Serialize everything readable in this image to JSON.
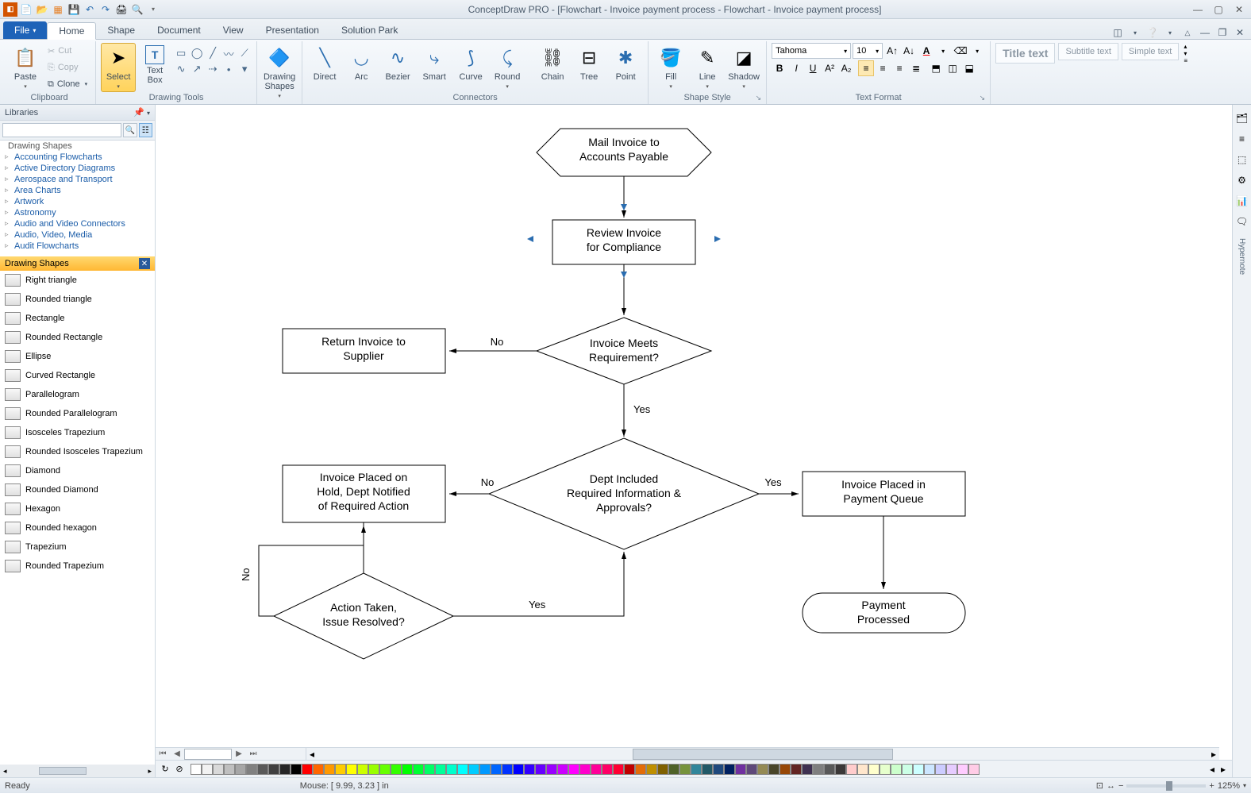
{
  "app": {
    "title": "ConceptDraw PRO - [Flowchart - Invoice payment process - Flowchart - Invoice payment process]"
  },
  "tabs": {
    "file": "File",
    "items": [
      "Home",
      "Shape",
      "Document",
      "View",
      "Presentation",
      "Solution Park"
    ],
    "active": 0
  },
  "ribbon": {
    "clipboard": {
      "label": "Clipboard",
      "paste": "Paste",
      "cut": "Cut",
      "copy": "Copy",
      "clone": "Clone"
    },
    "drawingtools": {
      "label": "Drawing Tools",
      "select": "Select",
      "textbox": "Text\nBox"
    },
    "drawingshapes": {
      "label": "Drawing\nShapes"
    },
    "connectors": {
      "label": "Connectors",
      "direct": "Direct",
      "arc": "Arc",
      "bezier": "Bezier",
      "smart": "Smart",
      "curve": "Curve",
      "round": "Round",
      "chain": "Chain",
      "tree": "Tree",
      "point": "Point"
    },
    "shapestyle": {
      "label": "Shape Style",
      "fill": "Fill",
      "line": "Line",
      "shadow": "Shadow"
    },
    "textformat": {
      "label": "Text Format",
      "font": "Tahoma",
      "size": "10"
    },
    "quickstyles": {
      "title": "Title\ntext",
      "subtitle": "Subtitle\ntext",
      "simple": "Simple\ntext"
    }
  },
  "leftpanel": {
    "header": "Libraries",
    "tree": [
      "Drawing Shapes",
      "Accounting Flowcharts",
      "Active Directory Diagrams",
      "Aerospace and Transport",
      "Area Charts",
      "Artwork",
      "Astronomy",
      "Audio and Video Connectors",
      "Audio, Video, Media",
      "Audit Flowcharts"
    ],
    "section": "Drawing Shapes",
    "shapes": [
      "Right triangle",
      "Rounded triangle",
      "Rectangle",
      "Rounded Rectangle",
      "Ellipse",
      "Curved Rectangle",
      "Parallelogram",
      "Rounded Parallelogram",
      "Isosceles Trapezium",
      "Rounded Isosceles Trapezium",
      "Diamond",
      "Rounded Diamond",
      "Hexagon",
      "Rounded hexagon",
      "Trapezium",
      "Rounded Trapezium"
    ]
  },
  "flowchart": {
    "n1": "Mail Invoice to\nAccounts Payable",
    "n2": "Review Invoice\nfor Compliance",
    "n3": "Invoice Meets\nRequirement?",
    "n4": "Return Invoice to\nSupplier",
    "n5": "Dept Included\nRequired Information &\nApprovals?",
    "n6": "Invoice Placed on\nHold, Dept Notified\nof Required Action",
    "n7": "Action Taken,\nIssue Resolved?",
    "n8": "Invoice Placed in\nPayment Queue",
    "n9": "Payment\nProcessed",
    "no": "No",
    "yes": "Yes"
  },
  "rightstrip": {
    "hypernote": "Hypernote"
  },
  "statusbar": {
    "ready": "Ready",
    "mouse": "Mouse: [ 9.99, 3.23 ] in",
    "zoom": "125%"
  },
  "colors": [
    "#ffffff",
    "#f2f2f2",
    "#d9d9d9",
    "#bfbfbf",
    "#a6a6a6",
    "#808080",
    "#595959",
    "#404040",
    "#262626",
    "#000000",
    "#ff0000",
    "#ff6600",
    "#ff9900",
    "#ffcc00",
    "#ffff00",
    "#ccff00",
    "#99ff00",
    "#66ff00",
    "#33ff00",
    "#00ff00",
    "#00ff33",
    "#00ff66",
    "#00ff99",
    "#00ffcc",
    "#00ffff",
    "#00ccff",
    "#0099ff",
    "#0066ff",
    "#0033ff",
    "#0000ff",
    "#3300ff",
    "#6600ff",
    "#9900ff",
    "#cc00ff",
    "#ff00ff",
    "#ff00cc",
    "#ff0099",
    "#ff0066",
    "#ff0033",
    "#c00000",
    "#e36c09",
    "#bf8f00",
    "#7f6000",
    "#4f6228",
    "#76933c",
    "#31869b",
    "#215967",
    "#1f497d",
    "#002060",
    "#7030a0",
    "#5f497a",
    "#948a54",
    "#494529",
    "#974706",
    "#632523",
    "#3f3151",
    "#7f7f7f",
    "#595959",
    "#3b3838",
    "#ffcccc",
    "#ffe6cc",
    "#ffffcc",
    "#e6ffcc",
    "#ccffcc",
    "#ccffe6",
    "#ccffff",
    "#cce6ff",
    "#ccccff",
    "#e6ccff",
    "#ffccff",
    "#ffcce6"
  ]
}
